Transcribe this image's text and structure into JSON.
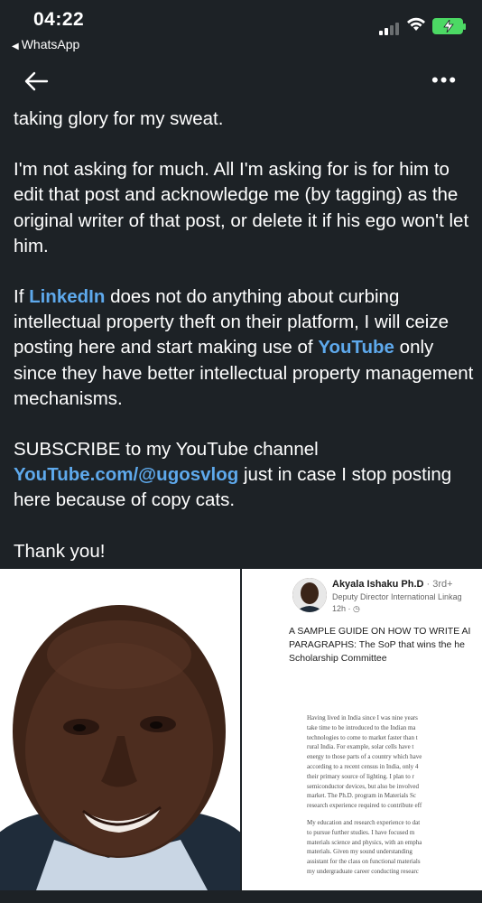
{
  "status_bar": {
    "time": "04:22",
    "back_app_label": "WhatsApp",
    "back_app_icon": "triangle-left-icon",
    "battery_color": "#4cd964"
  },
  "nav": {
    "back_icon": "arrow-left-icon",
    "more_icon": "more-horizontal-icon"
  },
  "post": {
    "p1": "taking glory for my sweat.",
    "p2": "I'm not asking for much. All I'm asking for is for him to edit that post and acknowledge me (by tagging) as the original writer of that post, or delete it if his ego won't let him.",
    "p3_a": "If ",
    "p3_link1": "LinkedIn",
    "p3_b": " does not do anything about curbing intellectual property theft on their platform, I will ceize posting here and start making use of ",
    "p3_link2": "YouTube",
    "p3_c": " only since they have better intellectual property management mechanisms.",
    "p4_a": "SUBSCRIBE to my YouTube channel ",
    "p4_link": "YouTube.com/@ugosvlog",
    "p4_b": " just in case I stop posting here because of copy cats.",
    "p5": "Thank you!",
    "link_color": "#5ea9ec"
  },
  "attachment": {
    "author_name": "Akyala Ishaku Ph.D",
    "author_degree": " · 3rd+",
    "author_title": "Deputy Director International Linkag",
    "author_time": "12h · ",
    "heading_lines": [
      "A SAMPLE GUIDE ON HOW TO WRITE AI",
      "PARAGRAPHS: The SoP that wins the he",
      "Scholarship Committee"
    ],
    "body_para1": [
      "Having lived in India since I was nine years",
      "take time to be introduced to the Indian ma",
      "technologies to come to market faster than t",
      "rural India. For example, solar cells have t",
      "energy to those parts of a country which have",
      "according to a recent census in India, only 4",
      "their primary source of lighting. I plan to r",
      "semiconductor devices, but also be involved",
      "market. The Ph.D. program in Materials Sc",
      "research experience required to contribute eff"
    ],
    "body_para2": [
      "My education and research experience to dat",
      "to pursue further studies. I have focused m",
      "materials science and physics, with an empha",
      "materials. Given my sound understanding",
      "assistant for the class on functional materials",
      "my undergraduate career conducting researc"
    ]
  }
}
